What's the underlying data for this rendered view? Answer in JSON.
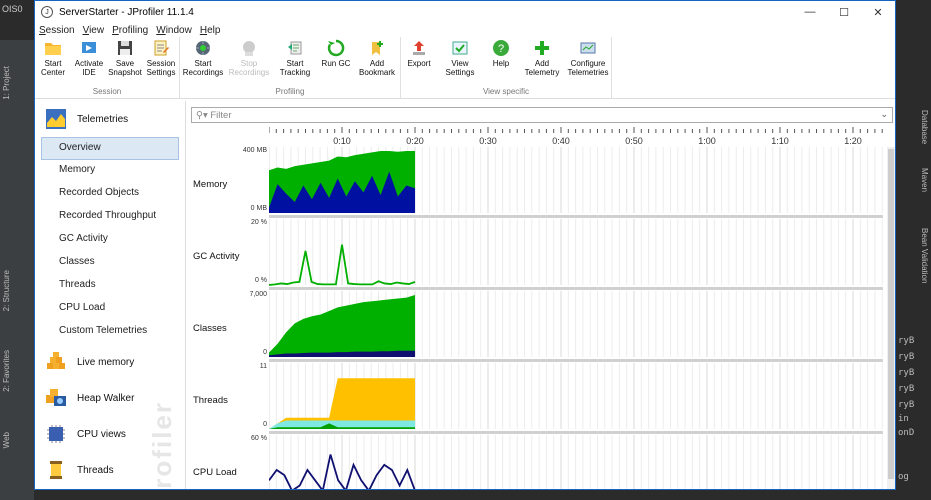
{
  "ide": {
    "left_top": "OIS0",
    "left_tabs": [
      "1: Project",
      "2: Structure",
      "2: Favorites",
      "Web"
    ],
    "right_tabs": [
      "Database",
      "Maven",
      "Bean Validation"
    ],
    "right_code": [
      "ryB",
      "ryB",
      "ryB",
      "ryB",
      "ryB",
      "in",
      "onD",
      "og"
    ]
  },
  "window": {
    "title": "ServerStarter - JProfiler 11.1.4",
    "minimize": "—",
    "maximize": "☐",
    "close": "✕"
  },
  "menu": [
    "Session",
    "View",
    "Profiling",
    "Window",
    "Help"
  ],
  "ribbon": {
    "groups": [
      {
        "label": "Session",
        "buttons": [
          {
            "l1": "Start",
            "l2": "Center",
            "icon": "folder-icon"
          },
          {
            "l1": "Activate",
            "l2": "IDE",
            "icon": "activate-icon"
          },
          {
            "l1": "Save",
            "l2": "Snapshot",
            "icon": "save-icon"
          },
          {
            "l1": "Session",
            "l2": "Settings",
            "icon": "settings-icon"
          }
        ]
      },
      {
        "label": "Profiling",
        "buttons": [
          {
            "l1": "Start",
            "l2": "Recordings",
            "icon": "recordings-icon"
          },
          {
            "l1": "Stop",
            "l2": "Recordings",
            "icon": "stop-icon",
            "disabled": true
          },
          {
            "l1": "Start",
            "l2": "Tracking",
            "icon": "tracking-icon"
          },
          {
            "l1": "Run GC",
            "l2": "",
            "icon": "gc-icon"
          },
          {
            "l1": "Add",
            "l2": "Bookmark",
            "icon": "bookmark-icon"
          }
        ]
      },
      {
        "label": "View specific",
        "buttons": [
          {
            "l1": "Export",
            "l2": "",
            "icon": "export-icon"
          },
          {
            "l1": "View",
            "l2": "Settings",
            "icon": "view-settings-icon"
          },
          {
            "l1": "Help",
            "l2": "",
            "icon": "help-icon"
          },
          {
            "l1": "Add",
            "l2": "Telemetry",
            "icon": "add-icon"
          },
          {
            "l1": "Configure",
            "l2": "Telemetries",
            "icon": "configure-icon"
          }
        ]
      }
    ]
  },
  "sidebar": {
    "sections": [
      {
        "label": "Telemetries",
        "icon": "telemetries-icon"
      },
      {
        "label": "Live memory",
        "icon": "live-memory-icon"
      },
      {
        "label": "Heap Walker",
        "icon": "heap-walker-icon"
      },
      {
        "label": "CPU views",
        "icon": "cpu-views-icon"
      },
      {
        "label": "Threads",
        "icon": "threads-icon"
      }
    ],
    "telemetry_items": [
      "Overview",
      "Memory",
      "Recorded Objects",
      "Recorded Throughput",
      "GC Activity",
      "Classes",
      "Threads",
      "CPU Load",
      "Custom Telemetries"
    ],
    "active": "Overview",
    "watermark": "Profiler"
  },
  "filter": {
    "placeholder": "Filter"
  },
  "timeline": {
    "labels": [
      "0:10",
      "0:20",
      "0:30",
      "0:40",
      "0:50",
      "1:00",
      "1:10",
      "1:20"
    ]
  },
  "colors": {
    "green": "#00b000",
    "blue": "#0010a0",
    "yellow": "#ffc000",
    "cyan": "#7fe8e0",
    "darkgreen": "#00a000",
    "navy": "#101070"
  },
  "chart_data": [
    {
      "type": "area",
      "title": "Memory",
      "ymax_label": "400 MB",
      "ymin_label": "0 MB",
      "series": [
        {
          "name": "",
          "values": [
            310,
            330,
            320,
            340,
            350,
            360,
            370,
            380,
            410,
            405,
            420,
            430,
            440,
            450,
            450,
            445,
            450,
            450
          ]
        },
        {
          "name": "",
          "values": [
            40,
            210,
            140,
            80,
            200,
            100,
            220,
            110,
            250,
            120,
            230,
            150,
            270,
            130,
            300,
            120,
            200,
            180
          ]
        }
      ]
    },
    {
      "type": "line",
      "title": "GC Activity",
      "ymax_label": "20 %",
      "ymin_label": "0 %",
      "values": [
        0,
        0.2,
        0.5,
        0.3,
        0.8,
        1,
        11,
        1,
        0.3,
        0.2,
        0.2,
        0.2,
        13,
        0.5,
        0.3,
        0.2,
        0.2,
        0.2,
        1.2,
        0.5,
        0.3,
        0.8,
        0.5,
        0.3,
        1
      ]
    },
    {
      "type": "area",
      "title": "Classes",
      "ymax_label": "7,000",
      "ymin_label": "0",
      "series": [
        {
          "name": "",
          "values": [
            500,
            1500,
            2800,
            3800,
            4300,
            4600,
            4800,
            5200,
            5600,
            5800,
            6000,
            6200,
            6300,
            6400,
            6500,
            6600,
            6700,
            7000
          ]
        },
        {
          "name": "",
          "values": [
            200,
            300,
            400,
            400,
            450,
            500,
            500,
            500,
            550,
            550,
            600,
            600,
            600,
            650,
            650,
            700,
            700,
            700
          ]
        }
      ]
    },
    {
      "type": "area",
      "title": "Threads",
      "ymax_label": "11",
      "ymin_label": "0",
      "series": [
        {
          "name": "",
          "values": [
            0,
            1,
            2,
            2,
            2,
            2,
            2,
            2,
            9,
            9,
            9,
            9,
            9,
            9,
            9,
            9,
            9,
            9
          ]
        },
        {
          "name": "",
          "values": [
            0,
            1,
            1.5,
            1.5,
            1.5,
            1.5,
            1.5,
            1.5,
            1.5,
            1.5,
            1.5,
            1.5,
            1.5,
            1.5,
            1.5,
            1.5,
            1.5,
            1.5
          ]
        },
        {
          "name": "",
          "values": [
            0,
            0.3,
            0.3,
            0.3,
            0.3,
            0.3,
            0.3,
            1,
            0.3,
            0.3,
            0.3,
            0.3,
            0.3,
            0.3,
            0.3,
            0.3,
            0.3,
            0.3
          ]
        }
      ]
    },
    {
      "type": "line",
      "title": "CPU Load",
      "ymax_label": "60 %",
      "ymin_label": "",
      "values": [
        20,
        30,
        25,
        10,
        15,
        30,
        20,
        10,
        45,
        20,
        10,
        35,
        20,
        10,
        25,
        35,
        30,
        15,
        30,
        10
      ]
    }
  ]
}
